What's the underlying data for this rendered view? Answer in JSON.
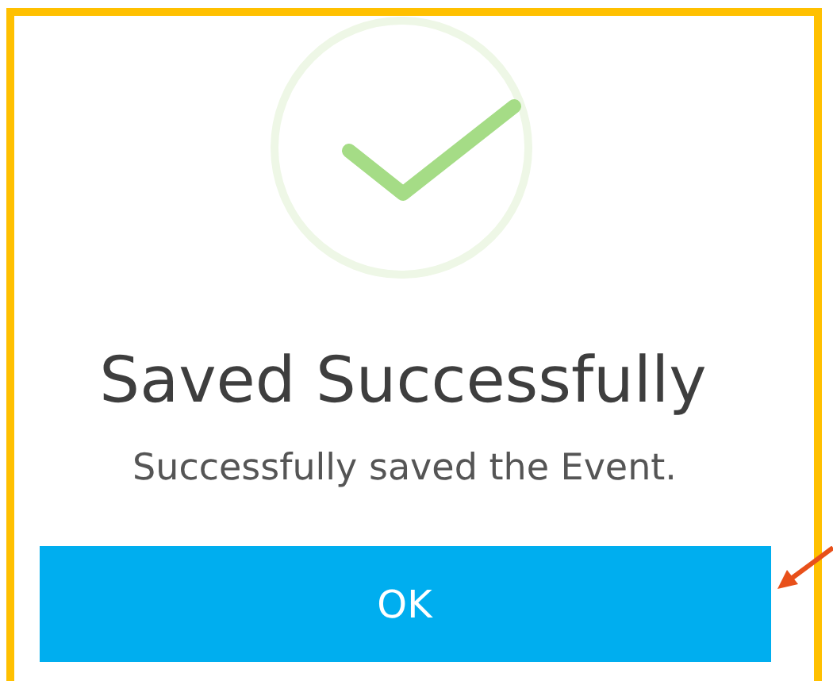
{
  "dialog": {
    "title": "Saved Successfully",
    "message": "Successfully saved the Event.",
    "button": "OK"
  }
}
